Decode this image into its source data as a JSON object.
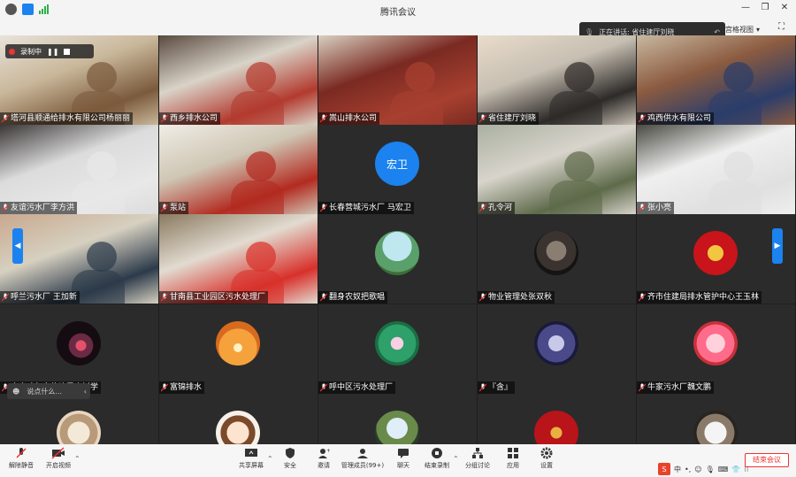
{
  "window": {
    "title": "腾讯会议",
    "controls": [
      "minimize",
      "restore",
      "close"
    ]
  },
  "speaking": {
    "label": "正在讲话: 省住建厅刘晓"
  },
  "view_label": "宫格视图",
  "recording": {
    "label": "录制中"
  },
  "chat_placeholder": "说点什么...",
  "participants": [
    {
      "name": "塔河县顺通给排水有限公司杨丽丽",
      "kind": "video",
      "colors": [
        "#c9b79a",
        "#7b5a3c",
        "#e8e3da"
      ]
    },
    {
      "name": "西乡排水公司",
      "kind": "video",
      "colors": [
        "#d9d3c8",
        "#b33a2e",
        "#5a4a40"
      ]
    },
    {
      "name": "嵩山排水公司",
      "kind": "video",
      "colors": [
        "#7a2a22",
        "#a84030",
        "#d8d0c0"
      ]
    },
    {
      "name": "省住建厅刘晓",
      "kind": "video",
      "colors": [
        "#c7bfb2",
        "#2d2a28",
        "#e9dccb"
      ]
    },
    {
      "name": "鸡西供水有限公司",
      "kind": "video",
      "colors": [
        "#8b5b40",
        "#2b3d6a",
        "#c8b8a0"
      ]
    },
    {
      "name": "友谊污水厂李方洪",
      "kind": "video",
      "colors": [
        "#dcdcdc",
        "#e8e8e8",
        "#3a3636"
      ]
    },
    {
      "name": "泵站",
      "kind": "video",
      "colors": [
        "#cfc6b4",
        "#b32a20",
        "#f0ede6"
      ]
    },
    {
      "name": "长春营城污水厂 马宏卫",
      "kind": "initials",
      "initials": "宏卫"
    },
    {
      "name": "孔令河",
      "kind": "video",
      "colors": [
        "#d8d4cc",
        "#5e6a4a",
        "#aab0a0"
      ]
    },
    {
      "name": "张小亮",
      "kind": "video",
      "colors": [
        "#efefef",
        "#e0e0e0",
        "#4a4a42"
      ]
    },
    {
      "name": "呼兰污水厂 王加新",
      "kind": "video",
      "colors": [
        "#d6d0c0",
        "#2c3a4a",
        "#c9a88e"
      ]
    },
    {
      "name": "甘南县工业园区污水处理厂",
      "kind": "video",
      "colors": [
        "#e2dbd0",
        "#d8302a",
        "#8a7a60"
      ]
    },
    {
      "name": "翻身农奴把歌唱",
      "kind": "avatar",
      "avatar": "landscape"
    },
    {
      "name": "物业管理处张双秋",
      "kind": "avatar",
      "avatar": "horse"
    },
    {
      "name": "齐市住建局排水管护中心王玉林",
      "kind": "avatar",
      "avatar": "emblem"
    },
    {
      "name": "齐齐哈尔市住建局李树学",
      "kind": "avatar",
      "avatar": "dark-floral"
    },
    {
      "name": "富锦排水",
      "kind": "avatar",
      "avatar": "sunset"
    },
    {
      "name": "呼中区污水处理厂",
      "kind": "avatar",
      "avatar": "lotus"
    },
    {
      "name": "『含』",
      "kind": "avatar",
      "avatar": "wolf"
    },
    {
      "name": "牛家污水厂魏文鹏",
      "kind": "avatar",
      "avatar": "pink-cartoon"
    },
    {
      "name": "",
      "kind": "avatar",
      "avatar": "cartoon-cat"
    },
    {
      "name": "",
      "kind": "avatar",
      "avatar": "cartoon-girl"
    },
    {
      "name": "",
      "kind": "avatar",
      "avatar": "palm"
    },
    {
      "name": "",
      "kind": "avatar",
      "avatar": "red-text"
    },
    {
      "name": "",
      "kind": "avatar",
      "avatar": "silhouette"
    }
  ],
  "toolbar": {
    "unmute": "解除静音",
    "video": "开启视频",
    "share": "共享屏幕",
    "security": "安全",
    "invite": "邀请",
    "members": "管理成员(99+)",
    "chat": "聊天",
    "record": "结束录制",
    "breakout": "分组讨论",
    "apps": "应用",
    "settings": "设置",
    "end": "结束会议"
  },
  "ime_label": "中"
}
